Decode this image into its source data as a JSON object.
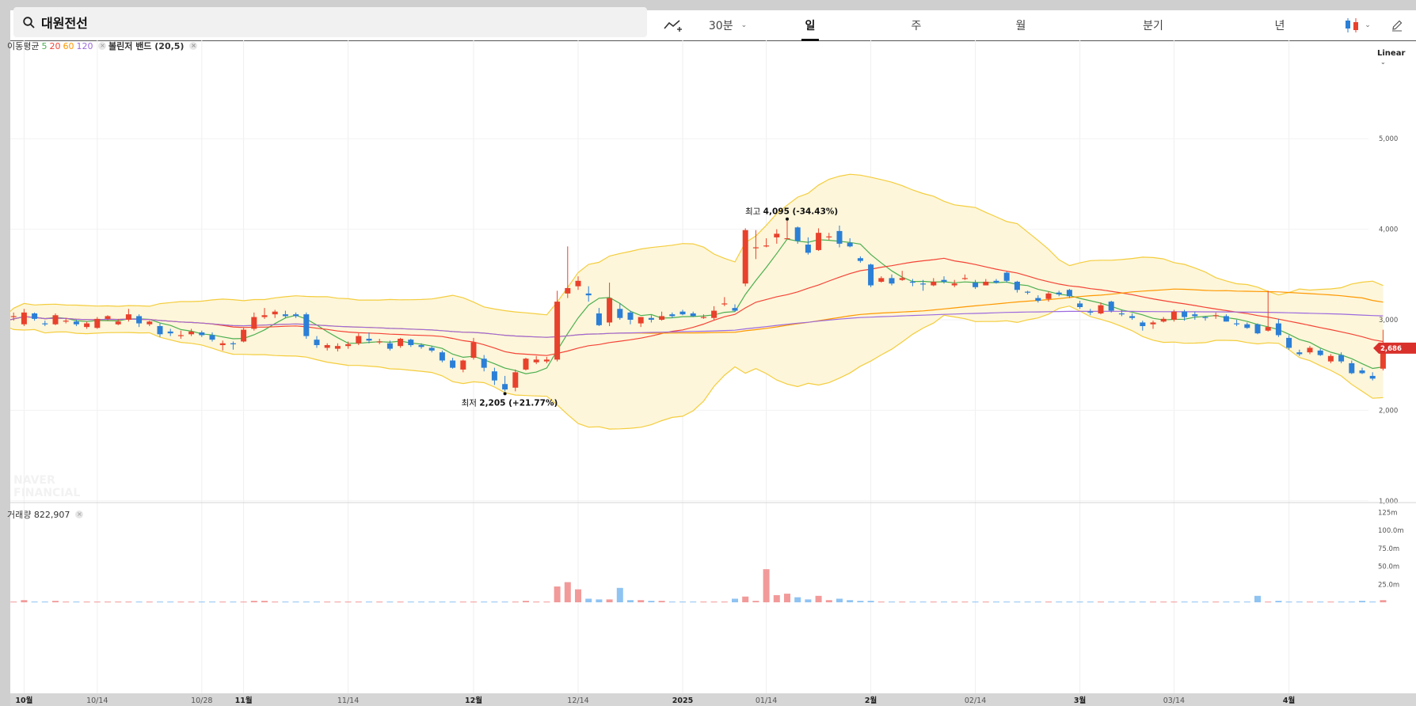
{
  "search": {
    "query": "대원전선"
  },
  "toolbar": {
    "interval_label": "30분",
    "tabs": [
      "일",
      "주",
      "월",
      "분기",
      "년"
    ],
    "active_tab": "일",
    "scale_label": "Linear"
  },
  "indicators": {
    "ma_label": "이동평균",
    "ma_periods": [
      "5",
      "20",
      "60",
      "120"
    ],
    "ma_colors": [
      "#4caf50",
      "#f44336",
      "#ff9800",
      "#9c6ade"
    ],
    "bb_label": "볼린저 밴드 (20,5)"
  },
  "volume_legend": "거래량 822,907",
  "watermark": "NAVER FINANCIAL",
  "colors": {
    "up": "#e8412c",
    "down": "#2b7fd6",
    "band_fill": "#fdf6da",
    "band_line": "#f4cd3e",
    "price_tag": "#d9302b"
  },
  "chart_data": {
    "type": "candlestick",
    "annotations": {
      "high": {
        "prefix": "최고",
        "value": "4,095",
        "change": "(-34.43%)"
      },
      "low": {
        "prefix": "최저",
        "value": "2,205",
        "change": "(+21.77%)"
      },
      "last_price": "2,686"
    },
    "price_axis": {
      "ticks": [
        1000,
        2000,
        3000,
        4000,
        5000
      ],
      "tick_labels": [
        "1,000",
        "2,000",
        "3,000",
        "4,000",
        "5,000"
      ],
      "ylim": [
        1000,
        5000
      ]
    },
    "volume_axis": {
      "tick_labels": [
        "25.0m",
        "50.0m",
        "75.0m",
        "100.0m",
        "125m"
      ],
      "ticks": [
        25,
        50,
        75,
        100,
        125
      ]
    },
    "date_labels": [
      {
        "label": "10월",
        "bold": true,
        "i": 2
      },
      {
        "label": "10/14",
        "bold": false,
        "i": 9
      },
      {
        "label": "10/28",
        "bold": false,
        "i": 19
      },
      {
        "label": "11월",
        "bold": true,
        "i": 23
      },
      {
        "label": "11/14",
        "bold": false,
        "i": 33
      },
      {
        "label": "12월",
        "bold": true,
        "i": 45
      },
      {
        "label": "12/14",
        "bold": false,
        "i": 55
      },
      {
        "label": "2025",
        "bold": true,
        "i": 65
      },
      {
        "label": "01/14",
        "bold": false,
        "i": 73
      },
      {
        "label": "2월",
        "bold": true,
        "i": 83
      },
      {
        "label": "02/14",
        "bold": false,
        "i": 93
      },
      {
        "label": "3월",
        "bold": true,
        "i": 103
      },
      {
        "label": "03/14",
        "bold": false,
        "i": 112
      },
      {
        "label": "4월",
        "bold": true,
        "i": 123
      }
    ],
    "ohlc": [
      [
        3180,
        3220,
        2950,
        2980
      ],
      [
        3030,
        3080,
        2990,
        3040
      ],
      [
        2950,
        3120,
        2930,
        3080
      ],
      [
        3070,
        3080,
        2990,
        3010
      ],
      [
        2960,
        2990,
        2930,
        2950
      ],
      [
        2950,
        3070,
        2940,
        3050
      ],
      [
        2990,
        3020,
        2960,
        2990
      ],
      [
        2980,
        3000,
        2930,
        2950
      ],
      [
        2920,
        2980,
        2900,
        2960
      ],
      [
        2910,
        3030,
        2900,
        3010
      ],
      [
        3010,
        3050,
        2990,
        3040
      ],
      [
        2950,
        3010,
        2940,
        2980
      ],
      [
        3000,
        3120,
        2980,
        3060
      ],
      [
        3040,
        3060,
        2920,
        2960
      ],
      [
        2950,
        2990,
        2930,
        2980
      ],
      [
        2930,
        2960,
        2810,
        2840
      ],
      [
        2870,
        2900,
        2820,
        2850
      ],
      [
        2820,
        2880,
        2790,
        2830
      ],
      [
        2840,
        2900,
        2820,
        2870
      ],
      [
        2860,
        2880,
        2810,
        2830
      ],
      [
        2830,
        2860,
        2760,
        2780
      ],
      [
        2720,
        2770,
        2660,
        2740
      ],
      [
        2740,
        2760,
        2670,
        2730
      ],
      [
        2760,
        2910,
        2750,
        2890
      ],
      [
        2900,
        3080,
        2880,
        3030
      ],
      [
        3030,
        3130,
        3010,
        3050
      ],
      [
        3060,
        3110,
        3020,
        3090
      ],
      [
        3060,
        3100,
        3020,
        3040
      ],
      [
        3060,
        3080,
        3020,
        3040
      ],
      [
        3060,
        3080,
        2790,
        2820
      ],
      [
        2780,
        2820,
        2690,
        2720
      ],
      [
        2690,
        2740,
        2660,
        2720
      ],
      [
        2680,
        2740,
        2650,
        2710
      ],
      [
        2710,
        2760,
        2680,
        2730
      ],
      [
        2740,
        2850,
        2720,
        2820
      ],
      [
        2790,
        2860,
        2740,
        2770
      ],
      [
        2760,
        2790,
        2730,
        2760
      ],
      [
        2740,
        2770,
        2660,
        2680
      ],
      [
        2710,
        2800,
        2690,
        2790
      ],
      [
        2780,
        2790,
        2700,
        2720
      ],
      [
        2720,
        2740,
        2680,
        2700
      ],
      [
        2690,
        2710,
        2640,
        2660
      ],
      [
        2640,
        2660,
        2530,
        2550
      ],
      [
        2550,
        2580,
        2460,
        2470
      ],
      [
        2450,
        2560,
        2420,
        2550
      ],
      [
        2580,
        2800,
        2560,
        2750
      ],
      [
        2570,
        2610,
        2430,
        2470
      ],
      [
        2430,
        2470,
        2280,
        2330
      ],
      [
        2290,
        2380,
        2210,
        2230
      ],
      [
        2250,
        2450,
        2210,
        2420
      ],
      [
        2450,
        2580,
        2440,
        2570
      ],
      [
        2530,
        2600,
        2510,
        2560
      ],
      [
        2540,
        2590,
        2520,
        2560
      ],
      [
        2560,
        3320,
        2540,
        3200
      ],
      [
        3290,
        3810,
        3240,
        3350
      ],
      [
        3370,
        3480,
        3330,
        3430
      ],
      [
        3290,
        3370,
        3200,
        3270
      ],
      [
        3070,
        3130,
        2930,
        2940
      ],
      [
        2970,
        3410,
        2930,
        3240
      ],
      [
        3120,
        3180,
        3000,
        3020
      ],
      [
        3080,
        3100,
        2950,
        3000
      ],
      [
        2960,
        3030,
        2920,
        3030
      ],
      [
        3020,
        3050,
        2970,
        3000
      ],
      [
        3000,
        3090,
        2990,
        3040
      ],
      [
        3060,
        3080,
        3020,
        3040
      ],
      [
        3090,
        3110,
        3050,
        3060
      ],
      [
        3070,
        3090,
        3030,
        3040
      ],
      [
        3030,
        3060,
        3010,
        3030
      ],
      [
        3020,
        3150,
        3000,
        3100
      ],
      [
        3170,
        3250,
        3150,
        3180
      ],
      [
        3130,
        3170,
        3090,
        3100
      ],
      [
        3400,
        4010,
        3370,
        3990
      ],
      [
        3800,
        3990,
        3670,
        3800
      ],
      [
        3820,
        3900,
        3800,
        3820
      ],
      [
        3910,
        4000,
        3840,
        3950
      ],
      [
        3900,
        4095,
        3890,
        3900
      ],
      [
        4020,
        4030,
        3840,
        3870
      ],
      [
        3830,
        3910,
        3720,
        3740
      ],
      [
        3770,
        4010,
        3760,
        3960
      ],
      [
        3910,
        3960,
        3880,
        3920
      ],
      [
        3980,
        4040,
        3800,
        3840
      ],
      [
        3850,
        3900,
        3800,
        3810
      ],
      [
        3680,
        3700,
        3630,
        3650
      ],
      [
        3610,
        3620,
        3360,
        3380
      ],
      [
        3420,
        3480,
        3410,
        3460
      ],
      [
        3460,
        3500,
        3380,
        3400
      ],
      [
        3440,
        3540,
        3430,
        3460
      ],
      [
        3420,
        3450,
        3370,
        3410
      ],
      [
        3400,
        3440,
        3320,
        3390
      ],
      [
        3380,
        3460,
        3370,
        3420
      ],
      [
        3440,
        3480,
        3400,
        3420
      ],
      [
        3380,
        3440,
        3360,
        3400
      ],
      [
        3450,
        3500,
        3440,
        3460
      ],
      [
        3410,
        3440,
        3340,
        3360
      ],
      [
        3380,
        3450,
        3380,
        3420
      ],
      [
        3430,
        3450,
        3400,
        3410
      ],
      [
        3520,
        3530,
        3410,
        3430
      ],
      [
        3420,
        3430,
        3300,
        3330
      ],
      [
        3310,
        3320,
        3280,
        3300
      ],
      [
        3240,
        3270,
        3190,
        3210
      ],
      [
        3230,
        3310,
        3200,
        3290
      ],
      [
        3300,
        3320,
        3260,
        3280
      ],
      [
        3330,
        3340,
        3240,
        3260
      ],
      [
        3180,
        3210,
        3120,
        3140
      ],
      [
        3090,
        3120,
        3050,
        3080
      ],
      [
        3070,
        3190,
        3060,
        3160
      ],
      [
        3200,
        3210,
        3080,
        3100
      ],
      [
        3070,
        3110,
        3040,
        3060
      ],
      [
        3040,
        3070,
        3000,
        3020
      ],
      [
        2970,
        2990,
        2880,
        2930
      ],
      [
        2950,
        2990,
        2900,
        2970
      ],
      [
        2980,
        3030,
        2970,
        3010
      ],
      [
        3000,
        3110,
        2980,
        3090
      ],
      [
        3090,
        3110,
        2990,
        3030
      ],
      [
        3060,
        3090,
        3000,
        3040
      ],
      [
        3030,
        3040,
        2990,
        3020
      ],
      [
        3040,
        3080,
        3010,
        3050
      ],
      [
        3040,
        3060,
        2980,
        2980
      ],
      [
        2960,
        3000,
        2930,
        2950
      ],
      [
        2950,
        2970,
        2900,
        2910
      ],
      [
        2950,
        2960,
        2840,
        2850
      ],
      [
        2880,
        3320,
        2870,
        2920
      ],
      [
        2960,
        3010,
        2810,
        2830
      ],
      [
        2800,
        2830,
        2670,
        2690
      ],
      [
        2640,
        2670,
        2600,
        2620
      ],
      [
        2640,
        2710,
        2620,
        2690
      ],
      [
        2660,
        2680,
        2600,
        2610
      ],
      [
        2540,
        2620,
        2520,
        2600
      ],
      [
        2610,
        2640,
        2520,
        2540
      ],
      [
        2520,
        2550,
        2400,
        2410
      ],
      [
        2440,
        2470,
        2400,
        2410
      ],
      [
        2380,
        2420,
        2330,
        2350
      ],
      [
        2460,
        2890,
        2440,
        2686
      ]
    ],
    "volume_m": [
      1,
      1,
      3,
      1,
      1,
      2,
      1,
      1,
      1,
      1,
      1,
      1,
      1,
      1,
      1,
      1,
      1,
      1,
      1,
      1,
      1,
      1,
      1,
      1,
      2,
      2,
      1,
      1,
      1,
      1,
      1,
      1,
      1,
      1,
      1,
      1,
      1,
      1,
      1,
      1,
      1,
      1,
      1,
      1,
      1,
      1,
      1,
      1,
      1,
      1,
      2,
      1,
      1,
      22,
      28,
      18,
      5,
      4,
      4,
      20,
      3,
      3,
      2,
      2,
      1,
      1,
      1,
      1,
      1,
      1,
      5,
      8,
      2,
      46,
      10,
      12,
      7,
      4,
      9,
      3,
      5,
      3,
      2,
      2,
      1,
      1,
      1,
      1,
      1,
      1,
      1,
      1,
      1,
      1,
      1,
      1,
      1,
      1,
      1,
      1,
      1,
      1,
      1,
      1,
      1,
      1,
      1,
      1,
      1,
      1,
      1,
      1,
      1,
      1,
      1,
      1,
      1,
      1,
      1,
      1,
      9,
      1,
      2,
      1,
      1,
      1,
      1,
      1,
      1,
      1,
      2,
      1,
      3
    ]
  }
}
